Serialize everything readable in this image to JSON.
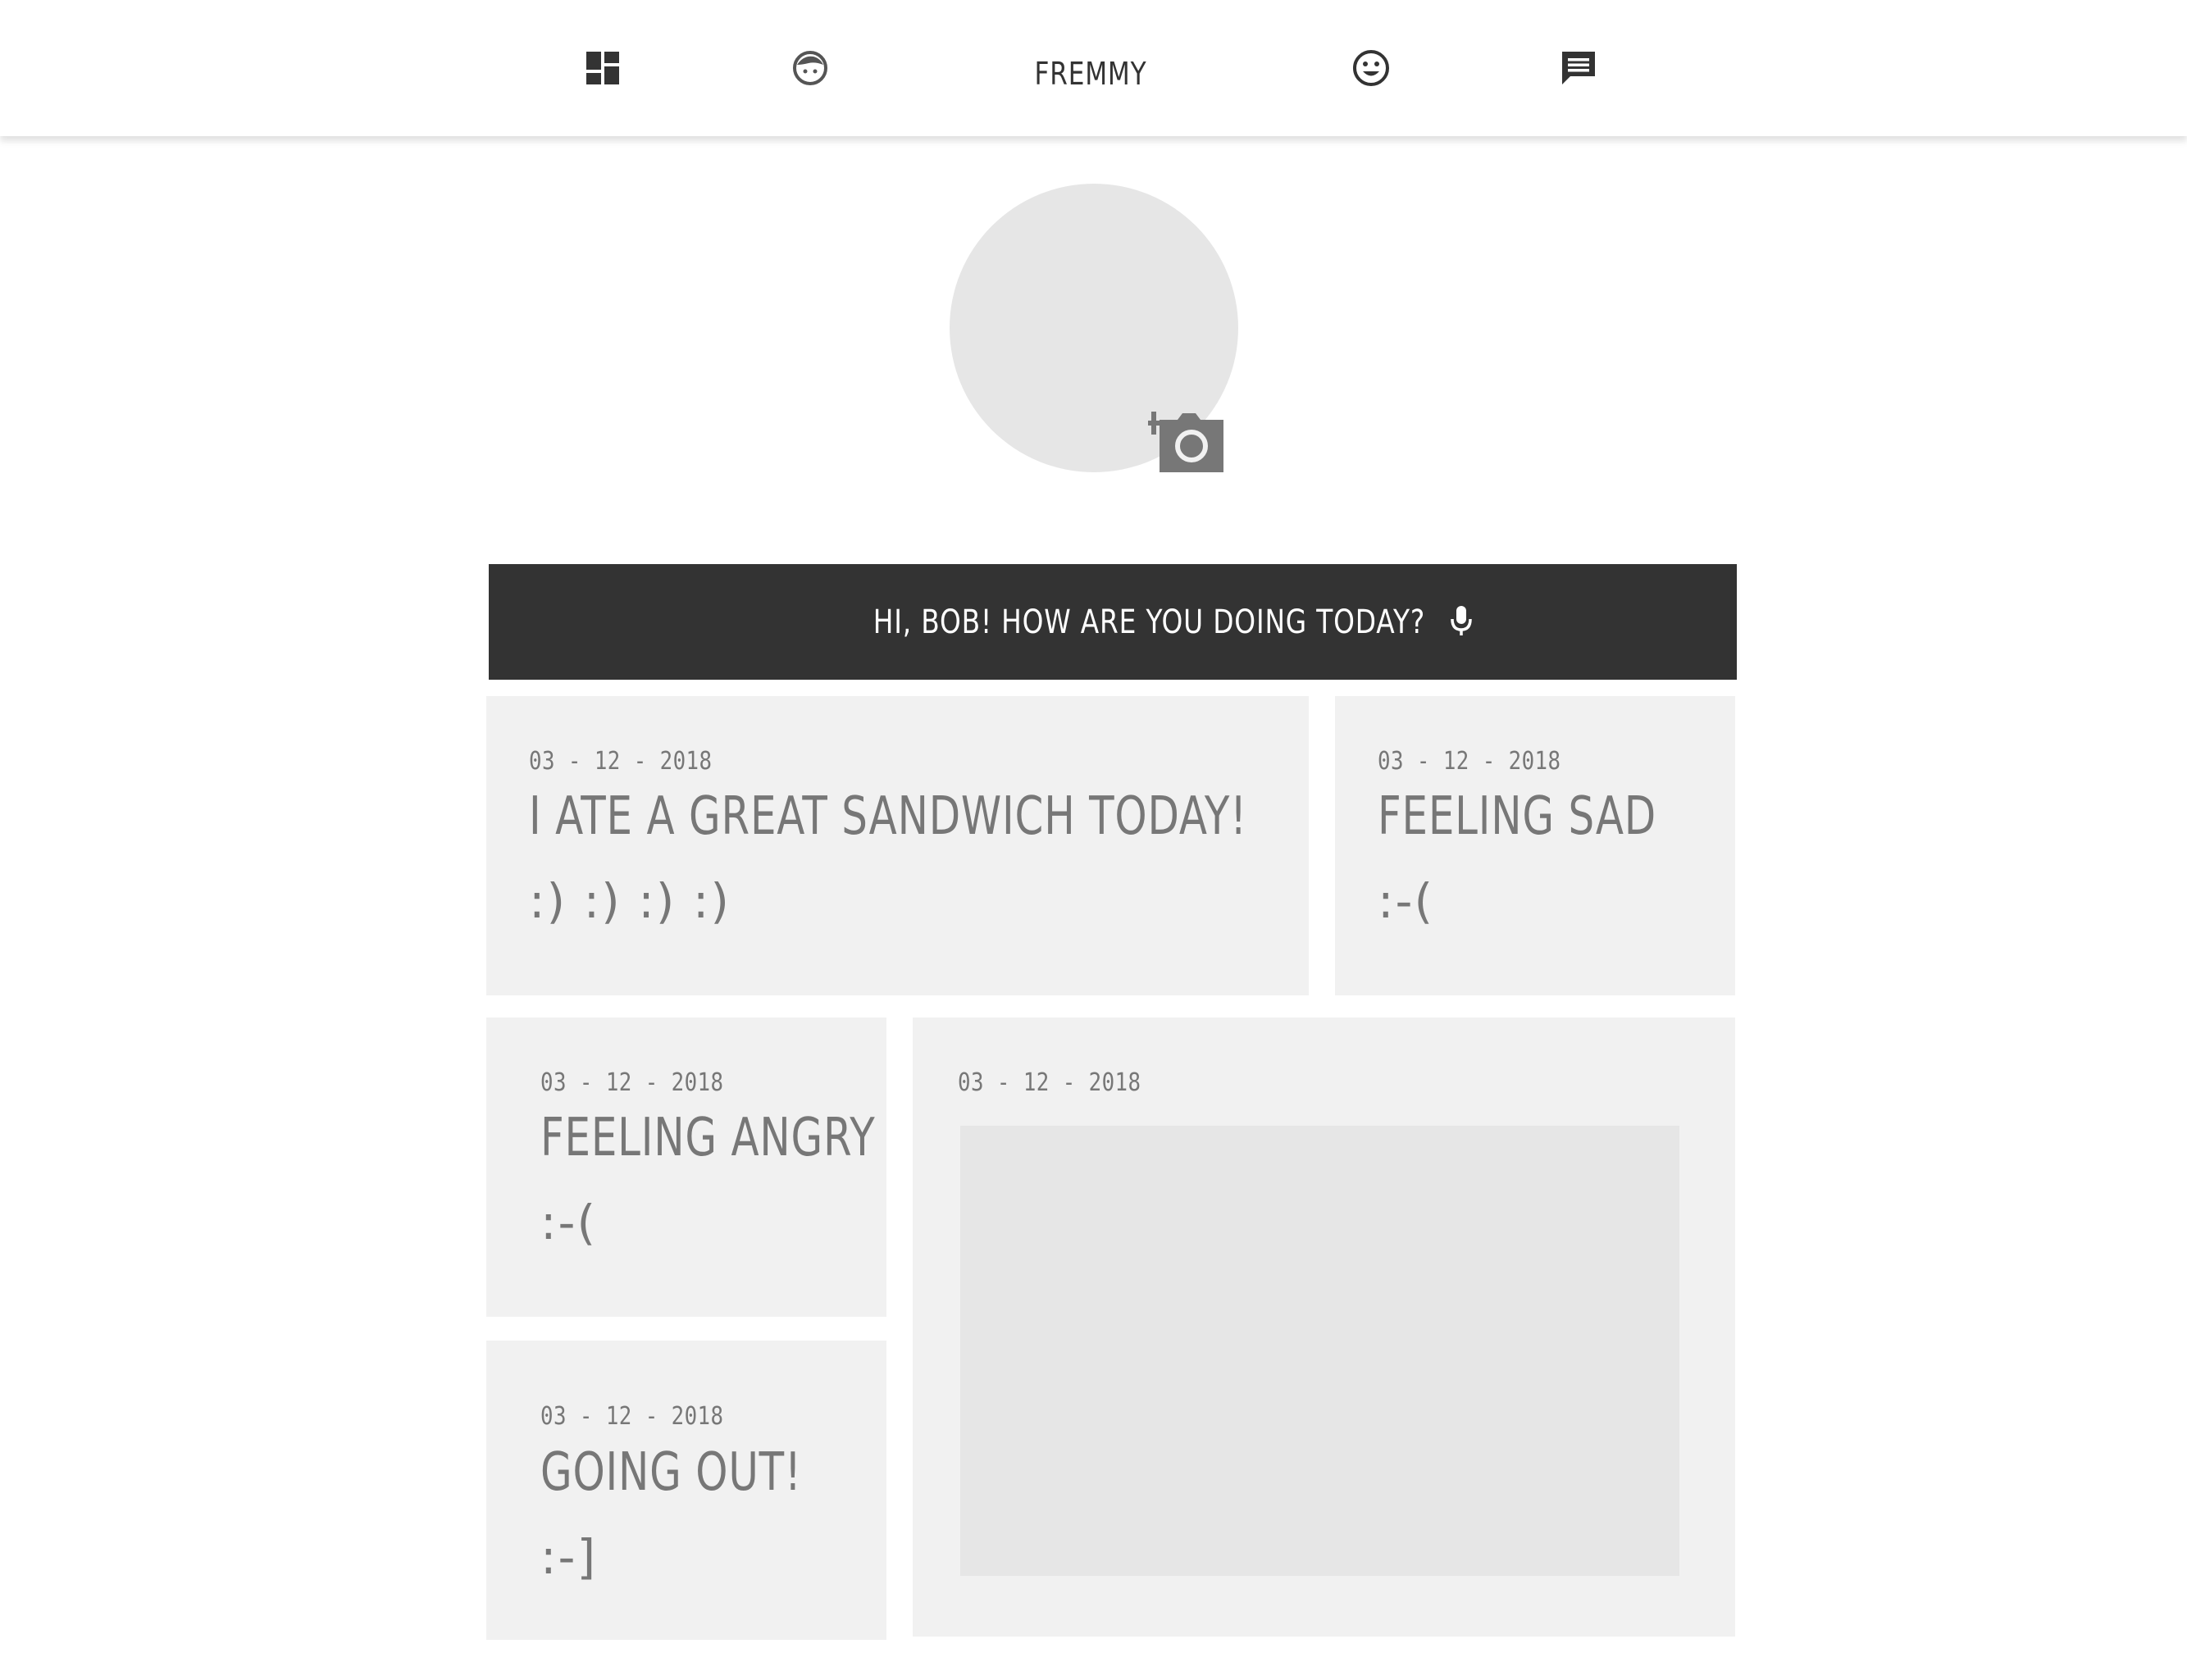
{
  "nav": {
    "brand": "FREMMY",
    "items": [
      {
        "name": "dashboard",
        "icon": "dashboard-icon"
      },
      {
        "name": "face",
        "icon": "face-icon"
      },
      {
        "name": "mood",
        "icon": "smiley-icon"
      },
      {
        "name": "messages",
        "icon": "chat-bubble-icon"
      }
    ]
  },
  "profile": {
    "add_photo_icon": "add-photo-icon"
  },
  "greeting": {
    "text": "HI, BOB! HOW ARE YOU DOING TODAY?",
    "mic_icon": "microphone-icon"
  },
  "entries": [
    {
      "date": "03 - 12 - 2018",
      "title": "I ATE A GREAT SANDWICH TODAY!",
      "emote": ":) :) :) :)"
    },
    {
      "date": "03 - 12 - 2018",
      "title": "FEELING SAD",
      "emote": ":-("
    },
    {
      "date": "03 - 12 - 2018",
      "title": "FEELING ANGRY",
      "emote": ":-("
    },
    {
      "date": "03 - 12 - 2018",
      "title": "",
      "emote": "",
      "has_photo": true
    },
    {
      "date": "03 - 12 - 2018",
      "title": "GOING OUT!",
      "emote": ":-]"
    }
  ],
  "colors": {
    "dark": "#333333",
    "card": "#f1f1f1",
    "placeholder": "#e6e6e6",
    "text_muted": "#777777"
  }
}
